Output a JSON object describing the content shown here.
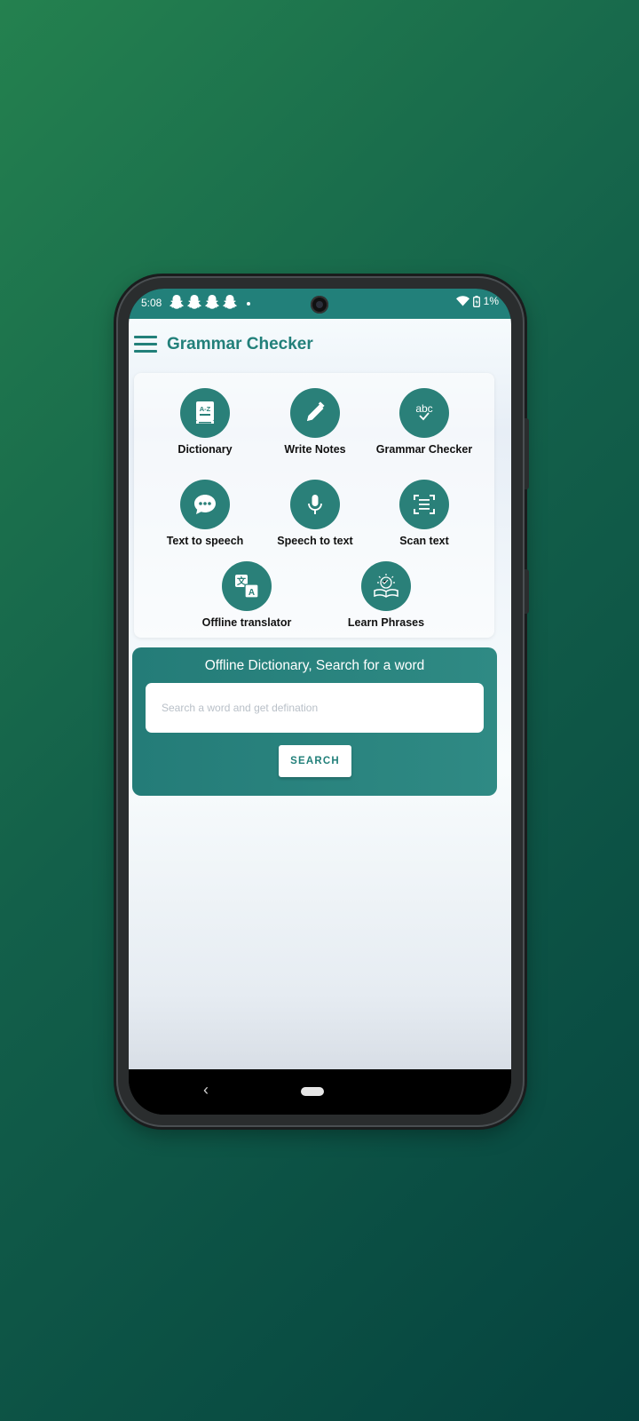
{
  "status_bar": {
    "time": "5:08",
    "battery": "1%",
    "icons": [
      "snapchat-icon",
      "snapchat-icon",
      "snapchat-icon",
      "snapchat-icon",
      "dot-icon",
      "wifi-icon",
      "battery-icon"
    ]
  },
  "app_bar": {
    "title": "Grammar Checker",
    "menu_icon": "hamburger-menu-icon"
  },
  "features": [
    {
      "label": "Dictionary",
      "icon": "dictionary-book-icon"
    },
    {
      "label": "Write Notes",
      "icon": "pencil-icon"
    },
    {
      "label": "Grammar Checker",
      "icon": "abc-check-icon"
    },
    {
      "label": "Text to speech",
      "icon": "chat-bubble-icon"
    },
    {
      "label": "Speech to text",
      "icon": "microphone-icon"
    },
    {
      "label": "Scan text",
      "icon": "scan-text-icon"
    },
    {
      "label": "Offline translator",
      "icon": "translate-icon"
    },
    {
      "label": "Learn Phrases",
      "icon": "open-book-icon"
    }
  ],
  "search": {
    "heading": "Offline Dictionary, Search for a word",
    "placeholder": "Search a word and get defination",
    "value": "",
    "button_label": "SEARCH"
  },
  "colors": {
    "primary": "#22807a",
    "background_gradient_start": "#24814f",
    "background_gradient_end": "#05433f"
  }
}
